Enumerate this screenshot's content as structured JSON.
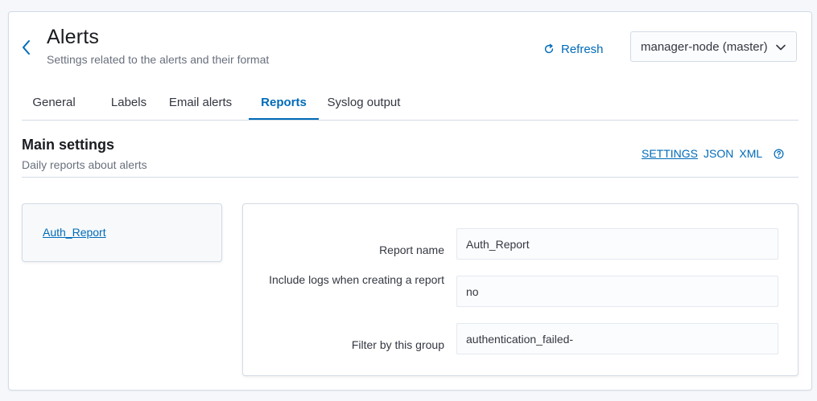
{
  "header": {
    "title": "Alerts",
    "subtitle": "Settings related to the alerts and their format",
    "refresh_label": "Refresh",
    "node_selector": "manager-node (master)"
  },
  "tabs": [
    {
      "label": "General",
      "active": false
    },
    {
      "label": "Labels",
      "active": false
    },
    {
      "label": "Email alerts",
      "active": false
    },
    {
      "label": "Reports",
      "active": true
    },
    {
      "label": "Syslog output",
      "active": false
    }
  ],
  "section": {
    "title": "Main settings",
    "subtitle": "Daily reports about alerts",
    "format_links": {
      "settings": "SETTINGS",
      "json": "JSON",
      "xml": "XML"
    }
  },
  "reports": {
    "items": [
      "Auth_Report"
    ]
  },
  "form": {
    "fields": [
      {
        "label": "Report name",
        "value": "Auth_Report"
      },
      {
        "label": "Include logs when creating a report",
        "value": "no"
      },
      {
        "label": "Filter by this group",
        "value": "authentication_failed-"
      }
    ]
  },
  "colors": {
    "accent": "#006bb8",
    "border": "#d3dae6",
    "background": "#f5f7fa"
  },
  "icons": {
    "back": "chevron-left-icon",
    "refresh": "refresh-icon",
    "dropdown": "chevron-down-icon",
    "help": "question-circle-icon"
  }
}
